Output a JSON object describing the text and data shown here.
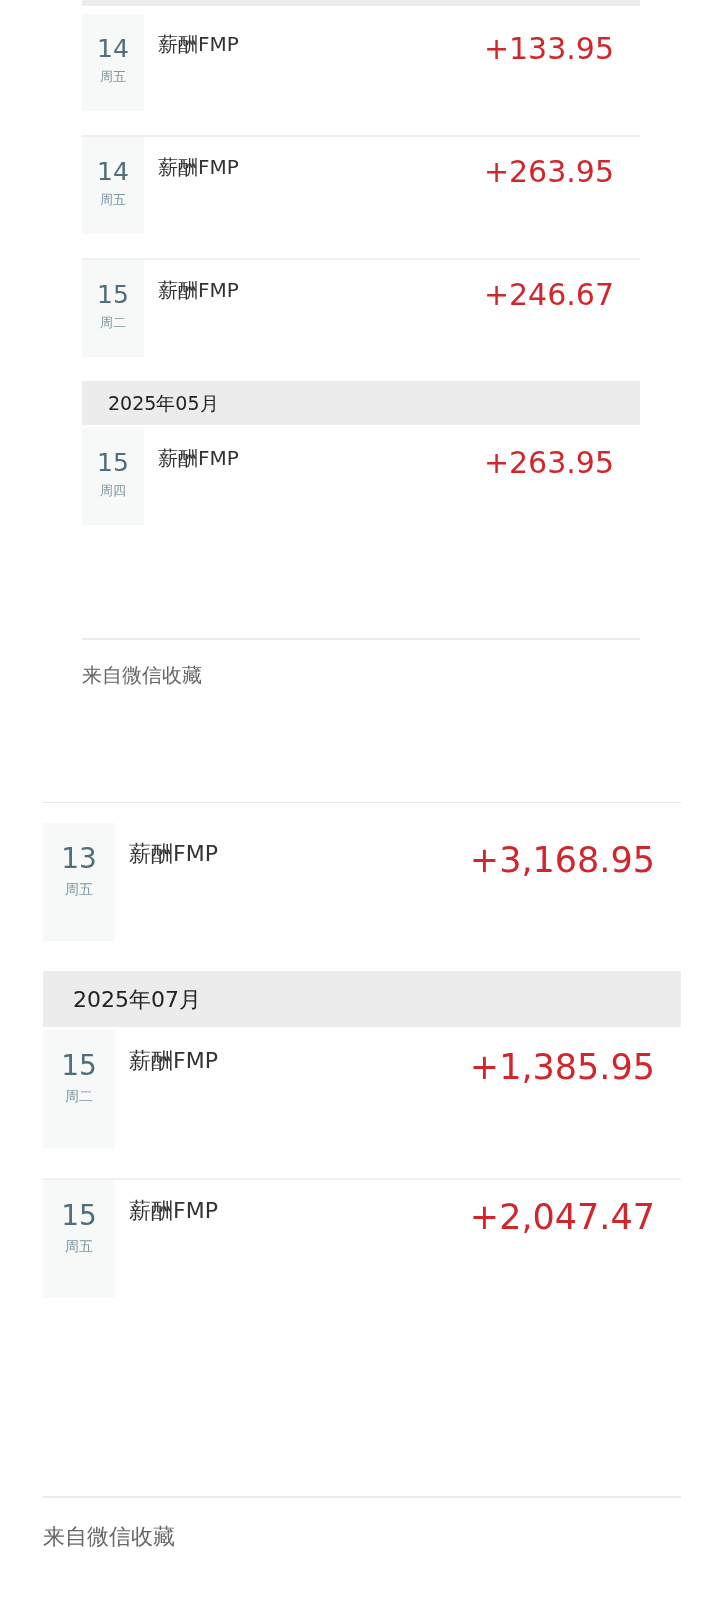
{
  "panels": [
    {
      "entries": [
        {
          "kind": "transaction",
          "day": "14",
          "weekday": "周五",
          "title": "薪酬FMP",
          "amount": "+133.95"
        },
        {
          "kind": "transaction",
          "day": "14",
          "weekday": "周五",
          "title": "薪酬FMP",
          "amount": "+263.95"
        },
        {
          "kind": "transaction",
          "day": "15",
          "weekday": "周二",
          "title": "薪酬FMP",
          "amount": "+246.67"
        },
        {
          "kind": "month",
          "label": "2025年05月"
        },
        {
          "kind": "transaction",
          "day": "15",
          "weekday": "周四",
          "title": "薪酬FMP",
          "amount": "+263.95"
        }
      ],
      "source": "来自微信收藏"
    },
    {
      "entries": [
        {
          "kind": "transaction",
          "day": "13",
          "weekday": "周五",
          "title": "薪酬FMP",
          "amount": "+3,168.95"
        },
        {
          "kind": "month",
          "label": "2025年07月"
        },
        {
          "kind": "transaction",
          "day": "15",
          "weekday": "周二",
          "title": "薪酬FMP",
          "amount": "+1,385.95"
        },
        {
          "kind": "transaction",
          "day": "15",
          "weekday": "周五",
          "title": "薪酬FMP",
          "amount": "+2,047.47"
        }
      ],
      "source": "来自微信收藏"
    }
  ]
}
